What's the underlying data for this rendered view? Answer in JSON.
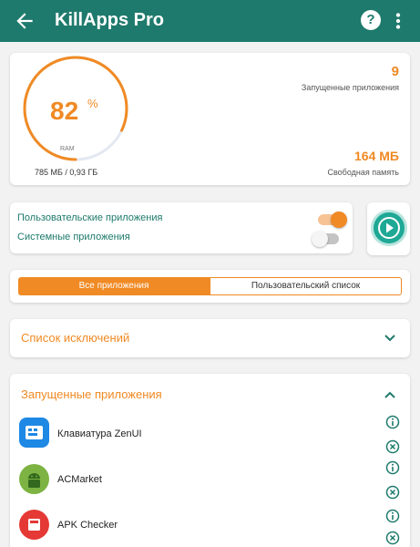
{
  "appbar": {
    "title": "KillApps Pro",
    "help_glyph": "?",
    "icons": [
      "back-arrow-icon",
      "help-icon",
      "more-vert-icon"
    ]
  },
  "ram": {
    "percent": "82",
    "percent_sign": "%",
    "fill_fraction": 0.82,
    "gauge_label": "RAM",
    "usage": "785 МБ / 0,93 ГБ",
    "running_count": "9",
    "running_label": "Запущенные приложения",
    "free_value": "164 МБ",
    "free_label": "Свободная память"
  },
  "toggles": {
    "user_apps": {
      "label": "Пользовательские приложения",
      "on": true
    },
    "system_apps": {
      "label": "Системные приложения",
      "on": false
    }
  },
  "tabs": {
    "all_apps": "Все приложения",
    "user_list": "Пользовательский список"
  },
  "exclusions": {
    "title": "Список исключений"
  },
  "running": {
    "title": "Запущенные приложения",
    "apps": [
      {
        "name": "Клавиатура ZenUI",
        "icon": "keyboard-app-icon"
      },
      {
        "name": "ACMarket",
        "icon": "android-app-icon"
      },
      {
        "name": "APK Checker",
        "icon": "apk-checker-app-icon"
      }
    ]
  },
  "colors": {
    "header": "#1e7a6c",
    "accent": "#f08a24",
    "teal": "#1ea896",
    "background": "#f2f2f2"
  }
}
